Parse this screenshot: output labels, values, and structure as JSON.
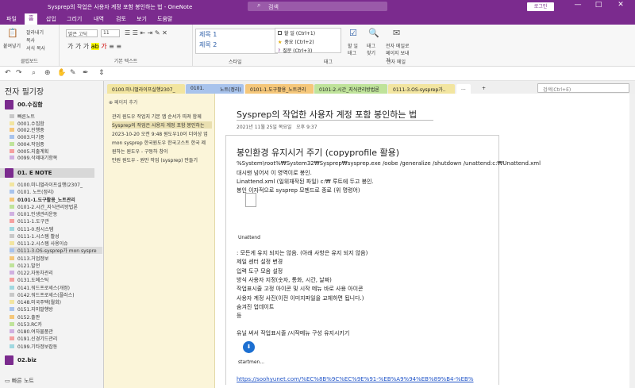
{
  "titlebar": {
    "title": "Sysprep의 작업은 사용자 계정 포함 봉인하는 법 - OneNote",
    "search_placeholder": "검색",
    "login": "로그인",
    "min": "—",
    "max": "□",
    "close": "✕"
  },
  "menu": [
    "파일",
    "홈",
    "삽입",
    "그리기",
    "내역",
    "검토",
    "보기",
    "도움말"
  ],
  "ribbon": {
    "clipboard": {
      "paste": "붙여넣기",
      "cut": "잘라내기",
      "copy": "복사",
      "format_painter": "서식 복사",
      "label": "클립보드"
    },
    "font": {
      "face": "맑은 고딕",
      "size": "11",
      "label": "기본 텍스트"
    },
    "styles": {
      "h1": "제목 1",
      "h2": "제목 2",
      "label": "스타일"
    },
    "tags": {
      "t1": "할 일 (Ctrl+1)",
      "t2": "중요 (Ctrl+2)",
      "t3": "질문 (Ctrl+3)",
      "todo": "할 일 태그",
      "find": "태그 찾기",
      "label": "태그"
    },
    "email": {
      "btn": "전자 메일로 페이지 보내기",
      "label": "전자 메일"
    }
  },
  "tabs": [
    {
      "label": "0100.미니멀라이프실행2307_",
      "color": "#f2e5a0"
    },
    {
      "label": "0101.",
      "color": "#a8c3ec"
    },
    {
      "label": "노트(정리)",
      "color": "#a8c3ec"
    },
    {
      "label": "0101-1.도구활용_노트관리",
      "color": "#f5c77a"
    },
    {
      "label": "0101-2.시간_지식관리방법론",
      "color": "#bfe39a"
    },
    {
      "label": "0111-3.OS-sysprep가..",
      "color": "#f2e5a0"
    }
  ],
  "tab_more": "...",
  "tab_add": "+",
  "page_search": "검색(Ctrl+E)",
  "notebooks": {
    "header": "전자 필기장",
    "nb1": "00.수집함",
    "nb1_sections": [
      "빠른노트",
      "0001.수집함",
      "0002.진행중",
      "0003.더기중",
      "0004.작업중",
      "0005.지출계획",
      "0099.삭제대기항목"
    ],
    "nb2": "01.               E NOTE",
    "nb2_sections": [
      "0100.미니멀라이프실행(2307_",
      "0101.               노트(정리)",
      "0101-1.도구활용_노트관리",
      "0101-2.시간_지식관리방법론",
      "0101.인생관리운동",
      "0111-1.도구관",
      "0111-0.컴시스템",
      "0111-1.시스템 활성",
      "0111-2.시스템 사용이슈",
      "0111-3.OS-sysprep가 mon syspre",
      "0113.거업정보",
      "0121.발전",
      "0122.자동차관리",
      "0131.도메스틱",
      "0141.워드프로세스(개정)",
      "0142.워드프로세스(플러스)",
      "0148.미국주택(월회)",
      "0151.지미발행방",
      "0152.출판",
      "0153.RC카",
      "0180.여자물품관",
      "0191.신경기드관리",
      "0199.기타정보잡동"
    ],
    "nb3": "02.biz",
    "footer": "빠른 노트"
  },
  "pages": {
    "add": "페이지 추가",
    "items": [
      "관리 원도우 작업지 기본 앱 순서가 따져 함께",
      "Sysprep의 작업은 사용자 계정 포함 봉인하는",
      "2023-10-20 오전 9:48 원도우10이 더이상 업",
      "mon sysprep 한국원도우 한국고스트 한국 제",
      "원하는 원도우 - 구동하 창이",
      "만원 원도우 - 원만 작업 (sysprep) 만들기"
    ]
  },
  "page": {
    "title": "Sysprep의 작업한 사용자 계정 포함 봉인하는 법",
    "date": "2021년 11월 25일 목요일",
    "time": "오후 9:37",
    "heading": "봉인환경 유지시거 주기 (copyprofile 활용)",
    "lines": [
      "%System\\root%₩System32₩Sysprep₩sysprep.exe /oobe /generalize /shutdown /unattend:c:₩Unattend.xml",
      "대시맨 넘어서 이 영역이로 봉인.",
      "Linattend.xml (일위재작된 파일) c:₩ 루트에 두고 봉인.",
      "봉인 이자적으로 sysprep 모멘드로 종료 (위 명령어)"
    ],
    "attach_name": "Unattend",
    "list": [
      ": 모든게 유지 되지는 않음. (아래 사항은 유지 되지 않음)",
      "제일 센터 설정 변경",
      "입력 도구 모음 설정",
      "방식 사용자 지정(숫자, 통화, 시간, 날짜)",
      "작업표시줄 고정 아이콘 및 시작 메뉴 바로 사용 아이콘",
      "사용자 계정 사진(이전 이미지파일을 교체하면 됩니다.)",
      "숨겨진 업데이트",
      "등"
    ],
    "sub": "유닐 써서 작업표시줄 /시작메뉴 구성 유지시키기",
    "attach2": "startmen...",
    "link": "https://soohyunet.com/%EC%8B%9C%EC%9E%91-%EB%A9%94%EB%89%B4-%EB%"
  }
}
